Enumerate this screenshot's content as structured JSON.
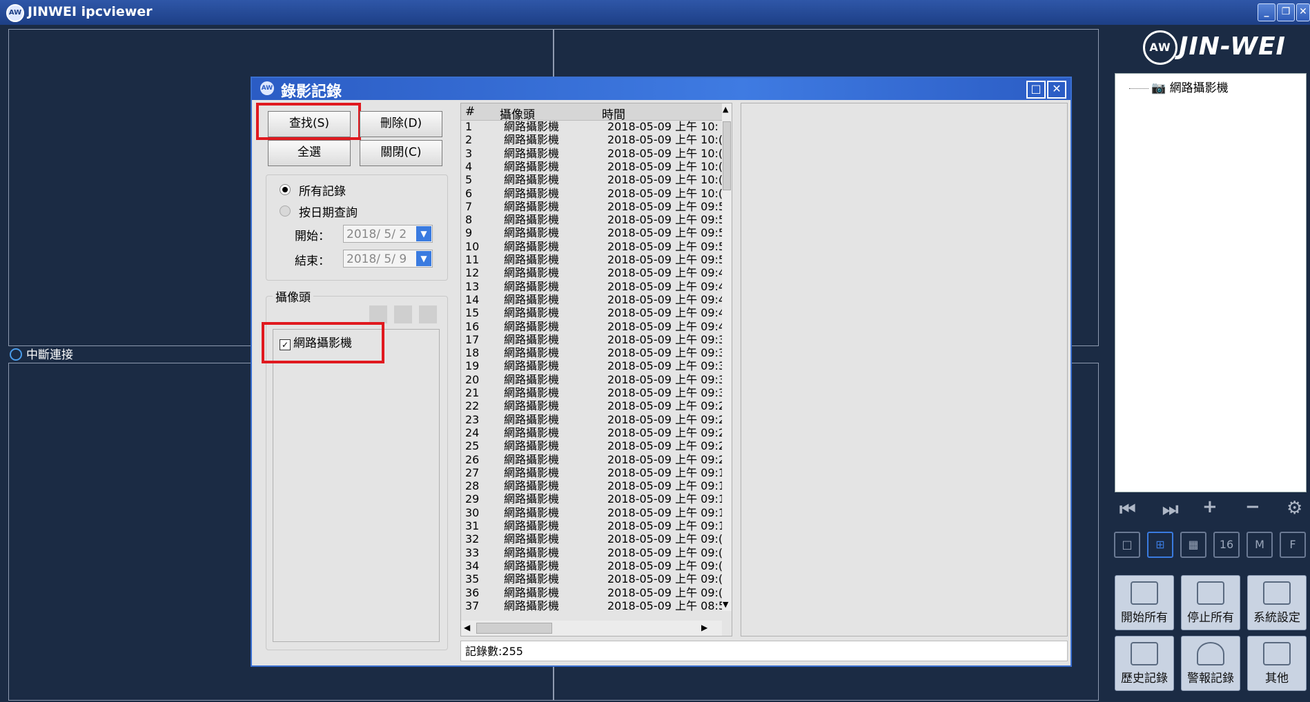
{
  "app": {
    "title": "JINWEI ipcviewer",
    "icon": "aw-logo-icon"
  },
  "window_controls": {
    "minimize": "_",
    "restore": "❐",
    "close": "✕"
  },
  "video_grid": {
    "status": "中斷連接"
  },
  "logo": {
    "mark": "AW",
    "text": "JIN-WEI"
  },
  "device_tree": {
    "root": "網路攝影機"
  },
  "side_controls": {
    "prev": "⏮",
    "next": "⏭",
    "add": "+",
    "remove": "−",
    "settings": "⚙"
  },
  "layouts": [
    "□",
    "⊞",
    "▦",
    "16",
    "M",
    "F"
  ],
  "action_buttons": [
    {
      "label": "開始所有",
      "icon": "start-all-icon"
    },
    {
      "label": "停止所有",
      "icon": "stop-all-icon"
    },
    {
      "label": "系統設定",
      "icon": "settings-icon"
    },
    {
      "label": "歷史記錄",
      "icon": "history-icon"
    },
    {
      "label": "警報記錄",
      "icon": "alarm-icon"
    },
    {
      "label": "其他",
      "icon": "wrench-icon"
    }
  ],
  "dialog": {
    "title": "錄影記錄",
    "buttons": {
      "search": "查找(S)",
      "delete": "刪除(D)",
      "select_all": "全選",
      "close": "關閉(C)"
    },
    "filter": {
      "all_records": "所有記錄",
      "by_date": "按日期查詢",
      "start_label": "開始：",
      "start_value": "2018/ 5/ 2",
      "end_label": "結束：",
      "end_value": "2018/ 5/ 9"
    },
    "camera_group": {
      "title": "攝像頭",
      "camera": "網路攝影機",
      "checked": true
    },
    "list": {
      "columns": [
        "#",
        "攝像頭",
        "時間"
      ],
      "rows": [
        [
          "1",
          "網路攝影機",
          "2018-05-09 上午 10:"
        ],
        [
          "2",
          "網路攝影機",
          "2018-05-09 上午 10:("
        ],
        [
          "3",
          "網路攝影機",
          "2018-05-09 上午 10:("
        ],
        [
          "4",
          "網路攝影機",
          "2018-05-09 上午 10:("
        ],
        [
          "5",
          "網路攝影機",
          "2018-05-09 上午 10:("
        ],
        [
          "6",
          "網路攝影機",
          "2018-05-09 上午 10:("
        ],
        [
          "7",
          "網路攝影機",
          "2018-05-09 上午 09:5"
        ],
        [
          "8",
          "網路攝影機",
          "2018-05-09 上午 09:5"
        ],
        [
          "9",
          "網路攝影機",
          "2018-05-09 上午 09:5"
        ],
        [
          "10",
          "網路攝影機",
          "2018-05-09 上午 09:5"
        ],
        [
          "11",
          "網路攝影機",
          "2018-05-09 上午 09:5"
        ],
        [
          "12",
          "網路攝影機",
          "2018-05-09 上午 09:4"
        ],
        [
          "13",
          "網路攝影機",
          "2018-05-09 上午 09:4"
        ],
        [
          "14",
          "網路攝影機",
          "2018-05-09 上午 09:4"
        ],
        [
          "15",
          "網路攝影機",
          "2018-05-09 上午 09:4"
        ],
        [
          "16",
          "網路攝影機",
          "2018-05-09 上午 09:4"
        ],
        [
          "17",
          "網路攝影機",
          "2018-05-09 上午 09:3"
        ],
        [
          "18",
          "網路攝影機",
          "2018-05-09 上午 09:3"
        ],
        [
          "19",
          "網路攝影機",
          "2018-05-09 上午 09:3"
        ],
        [
          "20",
          "網路攝影機",
          "2018-05-09 上午 09:3"
        ],
        [
          "21",
          "網路攝影機",
          "2018-05-09 上午 09:3"
        ],
        [
          "22",
          "網路攝影機",
          "2018-05-09 上午 09:2"
        ],
        [
          "23",
          "網路攝影機",
          "2018-05-09 上午 09:2"
        ],
        [
          "24",
          "網路攝影機",
          "2018-05-09 上午 09:2"
        ],
        [
          "25",
          "網路攝影機",
          "2018-05-09 上午 09:2"
        ],
        [
          "26",
          "網路攝影機",
          "2018-05-09 上午 09:2"
        ],
        [
          "27",
          "網路攝影機",
          "2018-05-09 上午 09:1"
        ],
        [
          "28",
          "網路攝影機",
          "2018-05-09 上午 09:1"
        ],
        [
          "29",
          "網路攝影機",
          "2018-05-09 上午 09:1"
        ],
        [
          "30",
          "網路攝影機",
          "2018-05-09 上午 09:1"
        ],
        [
          "31",
          "網路攝影機",
          "2018-05-09 上午 09:1"
        ],
        [
          "32",
          "網路攝影機",
          "2018-05-09 上午 09:("
        ],
        [
          "33",
          "網路攝影機",
          "2018-05-09 上午 09:("
        ],
        [
          "34",
          "網路攝影機",
          "2018-05-09 上午 09:("
        ],
        [
          "35",
          "網路攝影機",
          "2018-05-09 上午 09:("
        ],
        [
          "36",
          "網路攝影機",
          "2018-05-09 上午 09:("
        ],
        [
          "37",
          "網路攝影機",
          "2018-05-09 上午 08:5"
        ]
      ]
    },
    "status": "記錄數:255"
  },
  "colors": {
    "desktop": "#1b2b44",
    "title_bar": "#2f57a8",
    "dialog_title": "#3f7be2",
    "highlight": "#e0191f"
  }
}
